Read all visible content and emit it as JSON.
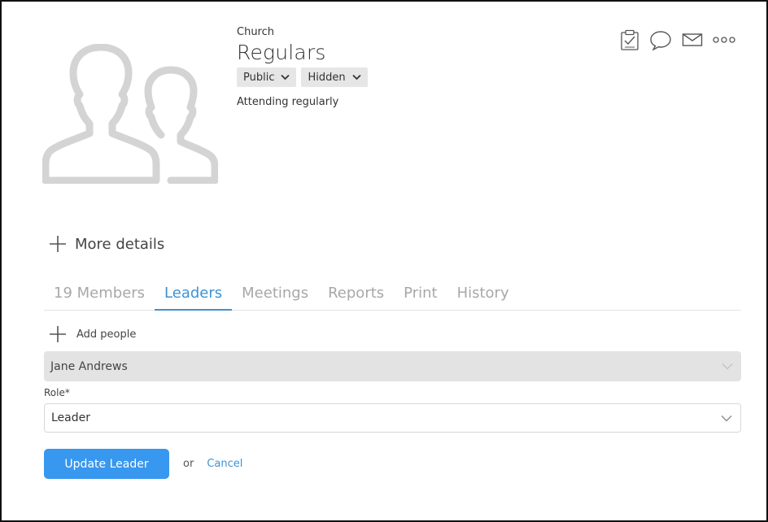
{
  "header": {
    "breadcrumb": "Church",
    "title": "Regulars",
    "visibility": "Public",
    "listing": "Hidden",
    "description": "Attending regularly"
  },
  "actions": {
    "icons": [
      "clipboard-check-icon",
      "speech-bubble-icon",
      "mail-icon",
      "more-icon"
    ]
  },
  "more_details": "More details",
  "tabs": [
    {
      "label": "19 Members",
      "active": false
    },
    {
      "label": "Leaders",
      "active": true
    },
    {
      "label": "Meetings",
      "active": false
    },
    {
      "label": "Reports",
      "active": false
    },
    {
      "label": "Print",
      "active": false
    },
    {
      "label": "History",
      "active": false
    }
  ],
  "add_people": "Add people",
  "form": {
    "person": "Jane Andrews",
    "role_label": "Role*",
    "role": "Leader",
    "submit": "Update Leader",
    "or": "or",
    "cancel": "Cancel"
  },
  "colors": {
    "accent": "#3d92d4",
    "button": "#3897ee",
    "placeholder_gray": "#d2d2d2"
  }
}
